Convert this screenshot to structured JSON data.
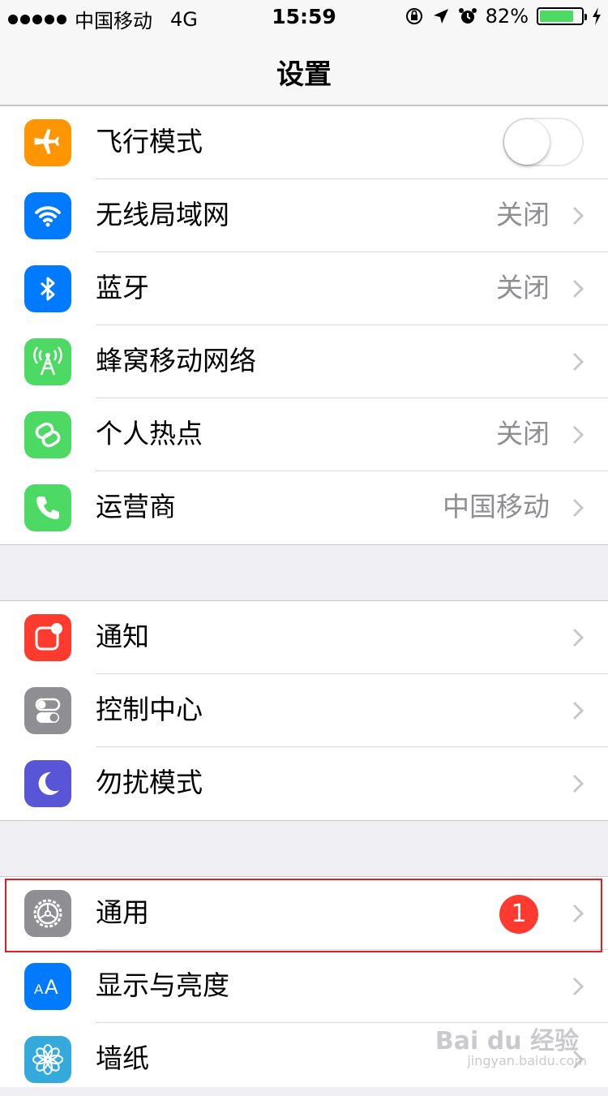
{
  "status_bar": {
    "carrier": "中国移动",
    "network": "4G",
    "time": "15:59",
    "battery_percent": "82%",
    "battery_level": 0.82,
    "icons": [
      "signal-dots",
      "orientation-lock-icon",
      "location-icon",
      "alarm-icon",
      "battery-icon",
      "charging-bolt-icon"
    ]
  },
  "nav": {
    "title": "设置"
  },
  "group1": [
    {
      "label": "飞行模式",
      "value": "",
      "icon": "airplane-icon",
      "color": "#ff9500",
      "toggle": false
    },
    {
      "label": "无线局域网",
      "value": "关闭",
      "icon": "wifi-icon",
      "color": "#007aff"
    },
    {
      "label": "蓝牙",
      "value": "关闭",
      "icon": "bluetooth-icon",
      "color": "#007aff"
    },
    {
      "label": "蜂窝移动网络",
      "value": "",
      "icon": "cellular-antenna-icon",
      "color": "#4cd964"
    },
    {
      "label": "个人热点",
      "value": "关闭",
      "icon": "hotspot-link-icon",
      "color": "#4cd964"
    },
    {
      "label": "运营商",
      "value": "中国移动",
      "icon": "phone-icon",
      "color": "#4cd964"
    }
  ],
  "group2": [
    {
      "label": "通知",
      "icon": "notifications-icon",
      "color": "#ff3b30"
    },
    {
      "label": "控制中心",
      "icon": "control-center-icon",
      "color": "#8e8e93"
    },
    {
      "label": "勿扰模式",
      "icon": "moon-icon",
      "color": "#5856d6"
    }
  ],
  "group3": [
    {
      "label": "通用",
      "badge": "1",
      "icon": "gear-icon",
      "color": "#8e8e93"
    },
    {
      "label": "显示与亮度",
      "icon": "text-size-icon",
      "color": "#007aff"
    },
    {
      "label": "墙纸",
      "icon": "flower-icon",
      "color": "#34aadc"
    }
  ],
  "watermark": {
    "brand": "Bai du 经验",
    "url": "jingyan.baidu.com"
  }
}
